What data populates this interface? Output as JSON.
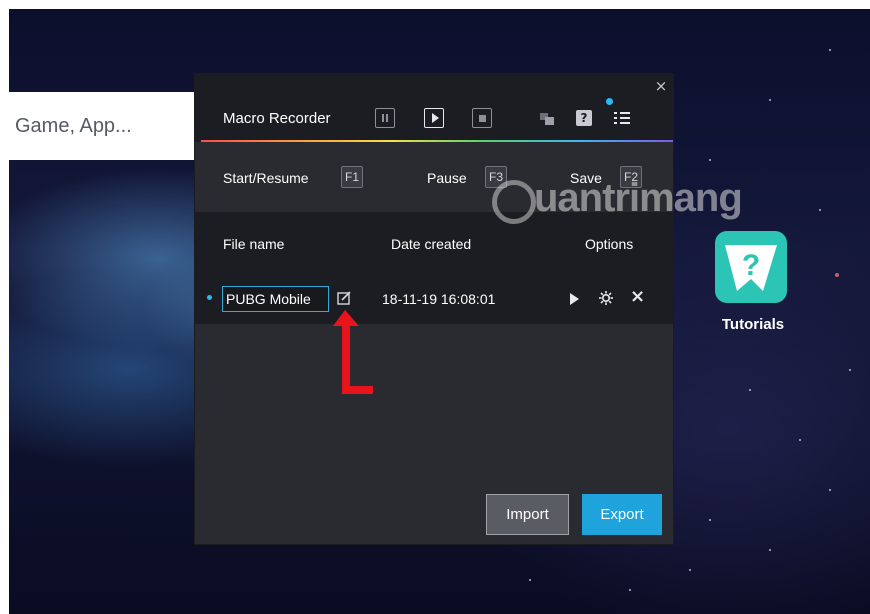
{
  "search": {
    "text": "Game, App..."
  },
  "macro_recorder": {
    "title": "Macro Recorder",
    "close_label": "×",
    "help_label": "?",
    "hotkeys": [
      {
        "label": "Start/Resume",
        "key": "F1"
      },
      {
        "label": "Pause",
        "key": "F3"
      },
      {
        "label": "Save",
        "key": "F2"
      }
    ],
    "columns": {
      "file_name": "File name",
      "date_created": "Date created",
      "options": "Options"
    },
    "rows": [
      {
        "file_name": "PUBG Mobile",
        "date_created": "18-11-19 16:08:01"
      }
    ],
    "import_label": "Import",
    "export_label": "Export",
    "accent_color": "#1fa3dc"
  },
  "watermark": {
    "text": "uantrimang"
  },
  "desktop_app": {
    "label": "Tutorials"
  }
}
